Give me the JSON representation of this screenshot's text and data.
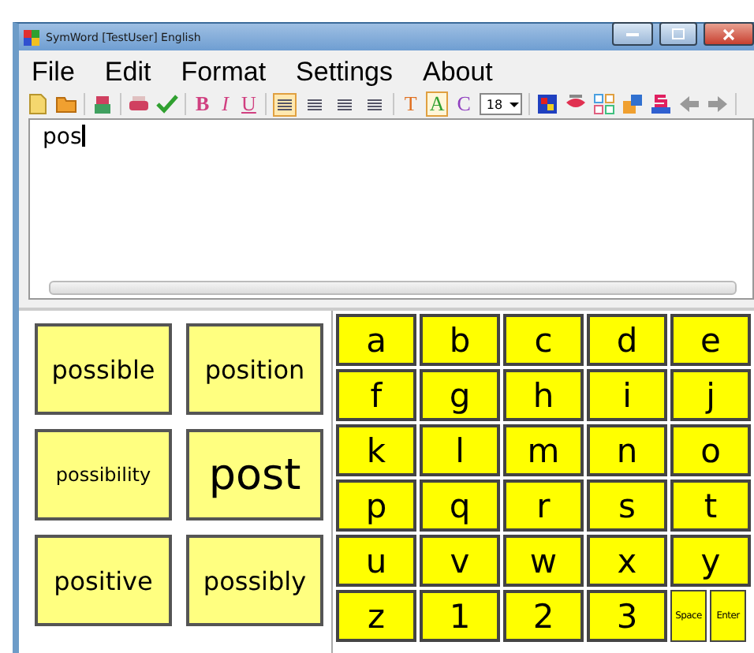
{
  "window": {
    "title": "SymWord [TestUser] English"
  },
  "menu": [
    {
      "label": "File"
    },
    {
      "label": "Edit"
    },
    {
      "label": "Format"
    },
    {
      "label": "Settings"
    },
    {
      "label": "About"
    }
  ],
  "toolbar": [
    {
      "kind": "icon"
    },
    {
      "kind": "icon"
    },
    {
      "kind": "separator"
    },
    {
      "kind": "icon"
    },
    {
      "kind": "separator"
    },
    {
      "kind": "icon"
    },
    {
      "kind": "icon"
    },
    {
      "kind": "separator"
    },
    {
      "kind": "bold",
      "label": "B",
      "color": "#d04080"
    },
    {
      "kind": "italic",
      "label": "I",
      "color": "#d04080"
    },
    {
      "kind": "underline",
      "label": "U",
      "color": "#d04080"
    },
    {
      "kind": "separator"
    },
    {
      "kind": "align",
      "selected": true
    },
    {
      "kind": "align",
      "selected": false
    },
    {
      "kind": "align",
      "selected": false
    },
    {
      "kind": "align",
      "selected": false
    },
    {
      "kind": "separator"
    },
    {
      "kind": "text",
      "label": "T",
      "color": "#e07020",
      "selected": false
    },
    {
      "kind": "text",
      "label": "A",
      "color": "#30a030",
      "selected": true
    },
    {
      "kind": "text",
      "label": "C",
      "color": "#9040c0",
      "selected": false
    },
    {
      "kind": "select",
      "value": "18"
    },
    {
      "kind": "separator"
    },
    {
      "kind": "icon"
    },
    {
      "kind": "icon"
    },
    {
      "kind": "icon"
    },
    {
      "kind": "icon"
    },
    {
      "kind": "icon"
    },
    {
      "kind": "icon"
    },
    {
      "kind": "icon"
    },
    {
      "kind": "separator"
    }
  ],
  "document": {
    "text": "pos"
  },
  "predictions": [
    {
      "label": "possible",
      "kind": "word"
    },
    {
      "label": "position",
      "kind": "word"
    },
    {
      "label": "possibility",
      "kind": "long"
    },
    {
      "label": "post",
      "kind": "featured"
    },
    {
      "label": "positive",
      "kind": "word"
    },
    {
      "label": "possibly",
      "kind": "word"
    }
  ],
  "keyboard": [
    [
      {
        "label": "a",
        "kind": "letter"
      },
      {
        "label": "b",
        "kind": "letter"
      },
      {
        "label": "c",
        "kind": "letter"
      },
      {
        "label": "d",
        "kind": "letter"
      },
      {
        "label": "e",
        "kind": "letter"
      }
    ],
    [
      {
        "label": "f",
        "kind": "letter"
      },
      {
        "label": "g",
        "kind": "letter"
      },
      {
        "label": "h",
        "kind": "letter"
      },
      {
        "label": "i",
        "kind": "letter"
      },
      {
        "label": "j",
        "kind": "letter"
      }
    ],
    [
      {
        "label": "k",
        "kind": "letter"
      },
      {
        "label": "l",
        "kind": "letter"
      },
      {
        "label": "m",
        "kind": "letter"
      },
      {
        "label": "n",
        "kind": "letter"
      },
      {
        "label": "o",
        "kind": "letter"
      }
    ],
    [
      {
        "label": "p",
        "kind": "letter"
      },
      {
        "label": "q",
        "kind": "letter"
      },
      {
        "label": "r",
        "kind": "letter"
      },
      {
        "label": "s",
        "kind": "letter"
      },
      {
        "label": "t",
        "kind": "letter"
      }
    ],
    [
      {
        "label": "u",
        "kind": "letter"
      },
      {
        "label": "v",
        "kind": "letter"
      },
      {
        "label": "w",
        "kind": "letter"
      },
      {
        "label": "x",
        "kind": "letter"
      },
      {
        "label": "y",
        "kind": "letter"
      }
    ],
    [
      {
        "label": "z",
        "kind": "letter"
      },
      {
        "label": "1",
        "kind": "letter"
      },
      {
        "label": "2",
        "kind": "letter"
      },
      {
        "label": "3",
        "kind": "letter"
      },
      {
        "label": "Space",
        "kind": "command"
      },
      {
        "label": "Enter",
        "kind": "command"
      }
    ]
  ]
}
